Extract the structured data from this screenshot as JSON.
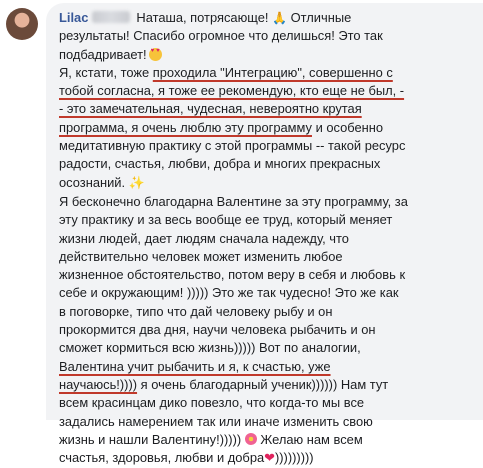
{
  "comment": {
    "author": "Lilac",
    "lines": {
      "l1": "Наташа, потрясающе!",
      "l1b": "Отличные",
      "l2": "результаты! Спасибо огромное что делишься! Это так",
      "l3": "подбадривает!",
      "l4a": "Я, кстати, тоже ",
      "l4b": "проходила \"Интеграцию\", совершенно с",
      "l5": "тобой согласна, я тоже ее рекомендую, кто еще не был, -",
      "l6": "- это замечательная, чудесная, невероятно крутая",
      "l7a": "программа, я очень люблю эту программу",
      "l7b": " и особенно",
      "l8": "медитативную практику с этой программы -- такой ресурс",
      "l9": "радости, счастья, любви, добра и многих прекрасных",
      "l10": "осознаний.",
      "l11": "Я бесконечно благодарна Валентине за эту программу, за",
      "l12": "эту практику и за весь вообще ее труд, который меняет",
      "l13": "жизни людей, дает людям сначала надежду, что",
      "l14": "действительно человек может изменить любое",
      "l15": "жизненное обстоятельство, потом веру в себя и любовь к",
      "l16": "себе и окружающим! ))))) Это же так чудесно! Это же как",
      "l17": "в поговорке, типо что дай человеку рыбу и он",
      "l18": "прокормится два дня, научи человека рыбачить и он",
      "l19": "сможет кормиться всю жизнь))))) Вот по аналогии,",
      "l20": "Валентина учит рыбачить и я, к счастью, уже",
      "l21a": "научаюсь!))))",
      "l21b": " я очень благодарный ученик)))))) Нам тут",
      "l22": "всем красинцам дико повезло, что когда-то мы все",
      "l23": "задались намерением так или иначе изменить свою",
      "l24a": "жизнь и нашли Валентину!)))))",
      "l24b": "Желаю нам всем",
      "l25a": "счастья, здоровья, любви и добра",
      "l25b": ")))))))))"
    },
    "emoji": {
      "pray": "🙏",
      "sparkle": "✨",
      "heart": "❤"
    }
  }
}
